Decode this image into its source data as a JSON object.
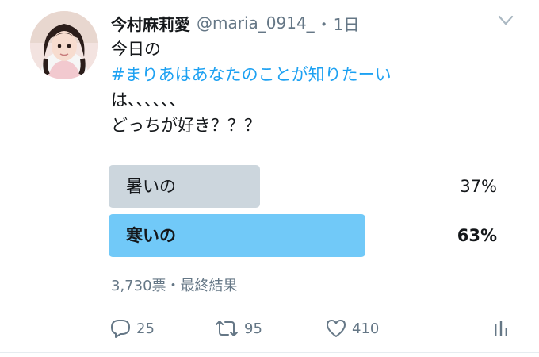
{
  "tweet": {
    "display_name": "今村麻莉愛",
    "handle": "@maria_0914_",
    "separator": "・",
    "time": "1日",
    "text_line1": "今日の",
    "hashtag": "#まりあはあなたのことが知りたーい",
    "text_line3": "は、、、、、、",
    "text_line4": "どっちが好き？？？"
  },
  "poll": {
    "options": [
      {
        "label": "暑いの",
        "percent_text": "37%",
        "fraction": 0.37,
        "color": "#ccd6dd",
        "winner": false
      },
      {
        "label": "寒いの",
        "percent_text": "63%",
        "fraction": 0.63,
        "color": "#71c9f8",
        "winner": true
      }
    ],
    "meta": "3,730票・最終結果"
  },
  "actions": {
    "reply_count": "25",
    "retweet_count": "95",
    "like_count": "410"
  },
  "colors": {
    "link": "#1da1f2",
    "secondary_text": "#657786",
    "primary_text": "#14171a"
  },
  "icons": [
    "avatar",
    "chevron-down-icon",
    "reply-icon",
    "retweet-icon",
    "like-icon",
    "analytics-icon"
  ]
}
